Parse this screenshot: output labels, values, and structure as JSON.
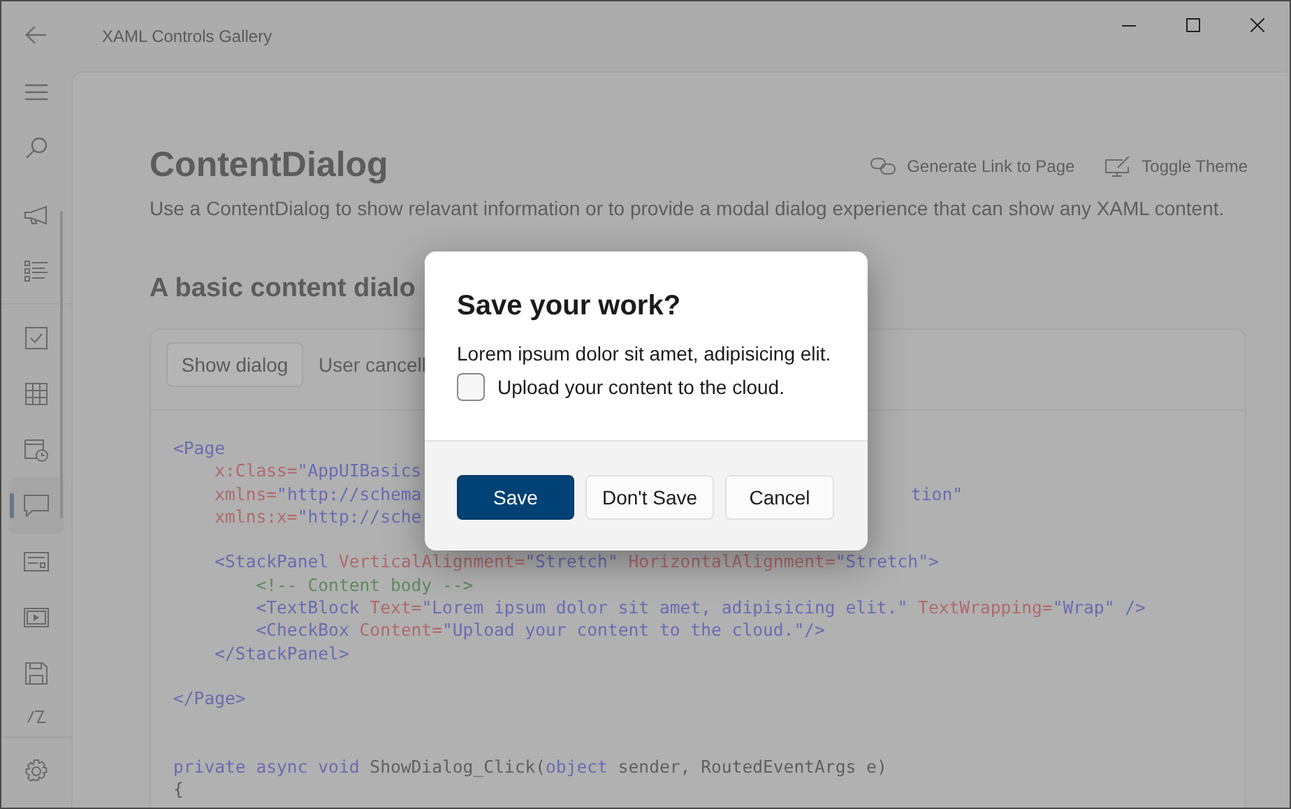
{
  "window": {
    "title": "XAML Controls Gallery"
  },
  "nav_items": [
    {
      "selected": false
    },
    {
      "selected": false
    },
    {
      "selected": false
    },
    {
      "selected": false
    },
    {
      "selected": false
    },
    {
      "selected": true
    },
    {
      "selected": false
    },
    {
      "selected": false
    },
    {
      "selected": false
    },
    {
      "selected": false
    }
  ],
  "page": {
    "title": "ContentDialog",
    "description": "Use a ContentDialog to show relavant information or to provide a modal dialog experience that can show any XAML content.",
    "actions": [
      "Generate Link to Page",
      "Toggle Theme"
    ],
    "section_title": "A basic content dialo"
  },
  "example": {
    "button": "Show dialog",
    "result": "User cancell",
    "code_lines": [
      {
        "kind": "code",
        "left": [
          {
            "kind": "tag",
            "text": "<Page"
          }
        ]
      },
      {
        "kind": "code",
        "left": [
          {
            "kind": "attr",
            "text": "    x:Class="
          },
          {
            "kind": "str",
            "text": "\"AppUIBasics"
          }
        ]
      },
      {
        "kind": "code",
        "left": [
          {
            "kind": "attr",
            "text": "    xmlns="
          },
          {
            "kind": "str",
            "text": "\"http://schema"
          }
        ],
        "right": [
          {
            "kind": "str",
            "text": "tion\""
          }
        ]
      },
      {
        "kind": "code",
        "left": [
          {
            "kind": "attr",
            "text": "    xmlns:x="
          },
          {
            "kind": "str",
            "text": "\"http://sche"
          }
        ]
      },
      {
        "kind": "blank"
      },
      {
        "kind": "code",
        "left": [
          {
            "kind": "tag",
            "text": "    <StackPanel"
          },
          {
            "kind": "attr",
            "text": " VerticalAlignment="
          },
          {
            "kind": "str",
            "text": "\"Stretch\""
          },
          {
            "kind": "attr",
            "text": " HorizontalAlignment="
          },
          {
            "kind": "str",
            "text": "\"Stretch\""
          },
          {
            "kind": "tag",
            "text": ">"
          }
        ]
      },
      {
        "kind": "code",
        "left": [
          {
            "kind": "comment",
            "text": "        <!-- Content body -->"
          }
        ]
      },
      {
        "kind": "code",
        "left": [
          {
            "kind": "tag",
            "text": "        <TextBlock"
          },
          {
            "kind": "attr",
            "text": " Text="
          },
          {
            "kind": "str",
            "text": "\"Lorem ipsum dolor sit amet, adipisicing elit.\""
          },
          {
            "kind": "attr",
            "text": " TextWrapping="
          },
          {
            "kind": "str",
            "text": "\"Wrap\""
          },
          {
            "kind": "tag",
            "text": " />"
          }
        ]
      },
      {
        "kind": "code",
        "left": [
          {
            "kind": "tag",
            "text": "        <CheckBox"
          },
          {
            "kind": "attr",
            "text": " Content="
          },
          {
            "kind": "str",
            "text": "\"Upload your content to the cloud.\""
          },
          {
            "kind": "tag",
            "text": "/>"
          }
        ]
      },
      {
        "kind": "code",
        "left": [
          {
            "kind": "tag",
            "text": "    </StackPanel>"
          }
        ]
      },
      {
        "kind": "blank"
      },
      {
        "kind": "code",
        "left": [
          {
            "kind": "tag",
            "text": "</Page>"
          }
        ]
      },
      {
        "kind": "blank"
      },
      {
        "kind": "blank"
      },
      {
        "kind": "code",
        "left": [
          {
            "kind": "kw",
            "text": "private async void"
          },
          {
            "kind": "plain",
            "text": " ShowDialog_Click("
          },
          {
            "kind": "kw",
            "text": "object"
          },
          {
            "kind": "plain",
            "text": " sender, RoutedEventArgs e)"
          }
        ]
      },
      {
        "kind": "code",
        "left": [
          {
            "kind": "plain",
            "text": "{"
          }
        ]
      }
    ]
  },
  "dialog": {
    "title": "Save your work?",
    "body": "Lorem ipsum dolor sit amet, adipisicing elit.",
    "checkbox": {
      "label": "Upload your content to the cloud.",
      "checked": false
    },
    "buttons": [
      {
        "label": "Save",
        "kind": "primary"
      },
      {
        "label": "Don't Save",
        "kind": "secondary"
      },
      {
        "label": "Cancel",
        "kind": "secondary"
      }
    ]
  }
}
